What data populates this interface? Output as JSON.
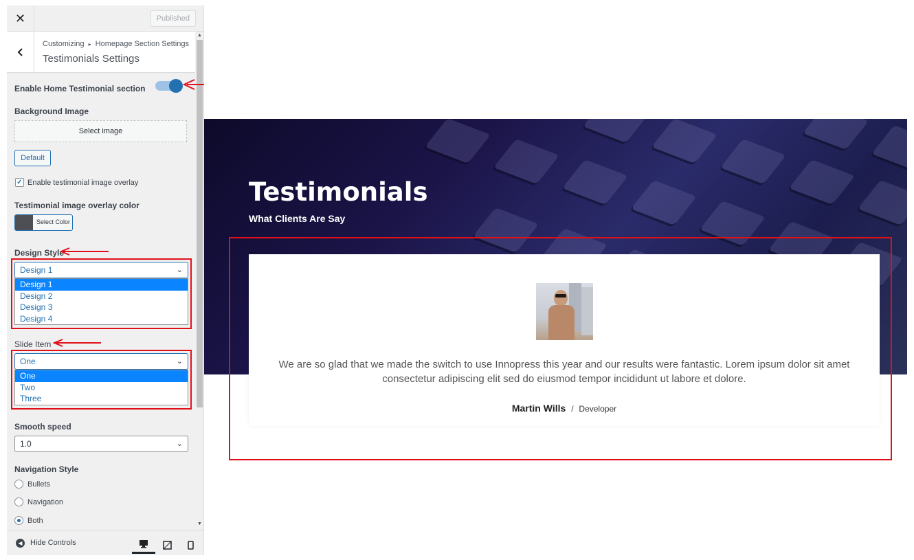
{
  "topbar": {
    "close_glyph": "✕",
    "published_label": "Published"
  },
  "section": {
    "breadcrumb_root": "Customizing",
    "breadcrumb_sep": "▸",
    "breadcrumb_parent": "Homepage Section Settings",
    "title": "Testimonials Settings"
  },
  "controls": {
    "enable_label": "Enable Home Testimonial section",
    "enable_on": true,
    "bg_image_label": "Background Image",
    "select_image": "Select image",
    "default_btn": "Default",
    "overlay_checkbox_label": "Enable testimonial image overlay",
    "overlay_checked": true,
    "overlay_color_label": "Testimonial image overlay color",
    "overlay_color_btn": "Select Color",
    "overlay_color_value": "#4e4e55",
    "design_style_label": "Design Style",
    "design_style_value": "Design 1",
    "design_style_options": [
      "Design 1",
      "Design 2",
      "Design 3",
      "Design 4"
    ],
    "slide_item_label": "Slide Item",
    "slide_item_value": "One",
    "slide_item_options": [
      "One",
      "Two",
      "Three"
    ],
    "smooth_speed_label": "Smooth speed",
    "smooth_speed_value": "1.0",
    "nav_style_label": "Navigation Style",
    "nav_options": [
      "Bullets",
      "Navigation",
      "Both"
    ],
    "nav_selected": "Both"
  },
  "footer": {
    "hide_label": "Hide Controls",
    "devices": [
      "desktop-icon",
      "tablet-icon",
      "mobile-icon"
    ]
  },
  "preview": {
    "title": "Testimonials",
    "subtitle": "What Clients Are Say",
    "quote": "We are so glad that we made the switch to use Innopress this year and our results were fantastic. Lorem ipsum dolor sit amet consectetur adipiscing elit sed do eiusmod tempor incididunt ut labore et dolore.",
    "author_name": "Martin Wills",
    "author_sep": "/",
    "author_role": "Developer"
  },
  "colors": {
    "accent": "#2271b1",
    "highlight": "#e0101a",
    "selected_option": "#0a84ff"
  }
}
